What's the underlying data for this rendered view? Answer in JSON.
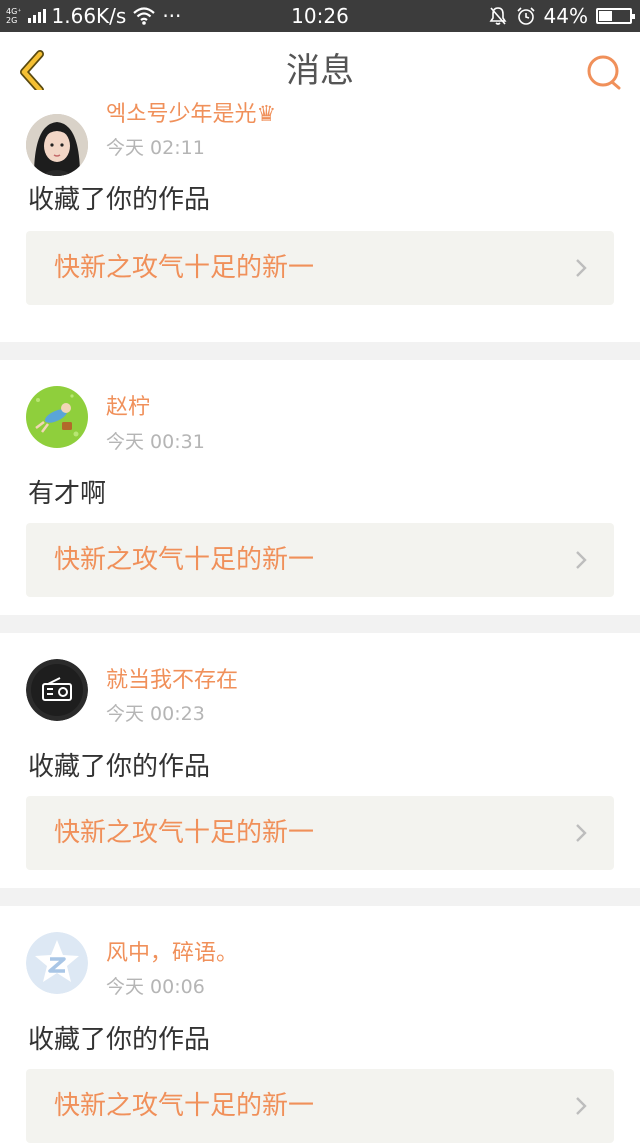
{
  "status_bar": {
    "net_top": "4G⁺",
    "net_bottom": "2G",
    "speed": "1.66K/s",
    "more": "···",
    "time": "10:26",
    "battery": "44%",
    "battery_level": 0.44
  },
  "header": {
    "title": "消息"
  },
  "messages": [
    {
      "user": "엑소号少年是光♛",
      "time": "今天 02:11",
      "action": "收藏了你的作品",
      "work": "快新之攻气十足的新一",
      "avatar": "photo-avatar"
    },
    {
      "user": "赵柠",
      "time": "今天 00:31",
      "action": "有才啊",
      "work": "快新之攻气十足的新一",
      "avatar": "cartoon-avatar"
    },
    {
      "user": "就当我不存在",
      "time": "今天 00:23",
      "action": "收藏了你的作品",
      "work": "快新之攻气十足的新一",
      "avatar": "radio-avatar"
    },
    {
      "user": "风中，碎语。",
      "time": "今天 00:06",
      "action": "收藏了你的作品",
      "work": "快新之攻气十足的新一",
      "avatar": "qzone-avatar"
    }
  ],
  "colors": {
    "accent": "#f0905a",
    "back_arrow": "#f5c033",
    "card_link_bg": "#f3f3ef",
    "status_bar_bg": "#3c3c3c"
  }
}
